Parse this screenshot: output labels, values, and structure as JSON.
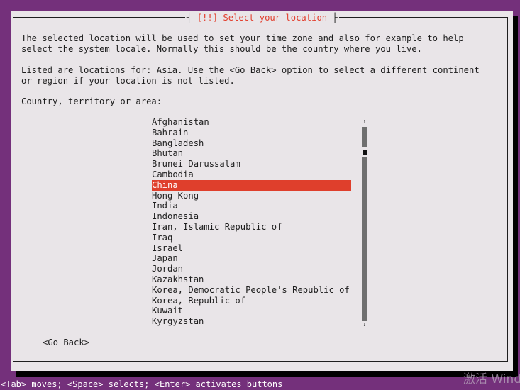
{
  "dialog": {
    "title_left": "┤ ",
    "title": "[!!] Select your location",
    "title_right": " ├",
    "intro_lines": [
      "The selected location will be used to set your time zone and also for example to help",
      "select the system locale. Normally this should be the country where you live."
    ],
    "listed_lines": [
      "Listed are locations for: Asia. Use the <Go Back> option to select a different continent",
      "or region if your location is not listed."
    ],
    "prompt": "Country, territory or area:",
    "countries": [
      "Afghanistan",
      "Bahrain",
      "Bangladesh",
      "Bhutan",
      "Brunei Darussalam",
      "Cambodia",
      "China",
      "Hong Kong",
      "India",
      "Indonesia",
      "Iran, Islamic Republic of",
      "Iraq",
      "Israel",
      "Japan",
      "Jordan",
      "Kazakhstan",
      "Korea, Democratic People's Republic of",
      "Korea, Republic of",
      "Kuwait",
      "Kyrgyzstan"
    ],
    "selected_index": 6,
    "scroll_up_icon": "↑",
    "scroll_down_icon": "↓",
    "go_back_label": "<Go Back>"
  },
  "footer": {
    "help": "<Tab> moves; <Space> selects; <Enter> activates buttons"
  },
  "watermark": {
    "text": "激活 Wind"
  },
  "colors": {
    "background": "#74307b",
    "dialog": "#e9e5e8",
    "selection": "#df3f2c",
    "title_text": "#e23e2d"
  }
}
